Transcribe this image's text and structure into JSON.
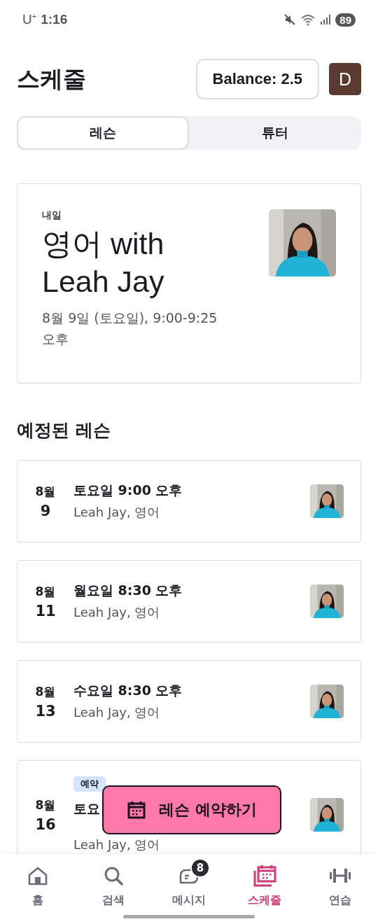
{
  "status_bar": {
    "carrier": "U$^{+}$",
    "time": "1:16",
    "battery": "89"
  },
  "header": {
    "title": "스케줄",
    "balance": "Balance: 2.5",
    "avatar_initial": "D"
  },
  "tabs": [
    {
      "label": "레슨",
      "selected": true
    },
    {
      "label": "튜터",
      "selected": false
    }
  ],
  "next_lesson": {
    "when": "내일",
    "title": "영어 with Leah Jay",
    "datetime": "8월 9일 (토요일), 9:00-9:25 오후"
  },
  "upcoming": {
    "heading": "예정된 레슨",
    "lessons": [
      {
        "month": "8월",
        "day": "9",
        "time": "토요일 9:00 오후",
        "detail": "Leah Jay, 영어"
      },
      {
        "month": "8월",
        "day": "11",
        "time": "월요일 8:30 오후",
        "detail": "Leah Jay, 영어"
      },
      {
        "month": "8월",
        "day": "13",
        "time": "수요일 8:30 오후",
        "detail": "Leah Jay, 영어"
      },
      {
        "month": "8월",
        "day": "16",
        "badge": "예약",
        "time": "토요",
        "detail": "Leah Jay, 영어"
      }
    ]
  },
  "book_button": {
    "label": "레슨 예약하기"
  },
  "bottom_nav": [
    {
      "label": "홈",
      "selected": false
    },
    {
      "label": "검색",
      "selected": false
    },
    {
      "label": "메시지",
      "badge": "8",
      "selected": false
    },
    {
      "label": "스케줄",
      "selected": true
    },
    {
      "label": "연습",
      "selected": false
    }
  ]
}
